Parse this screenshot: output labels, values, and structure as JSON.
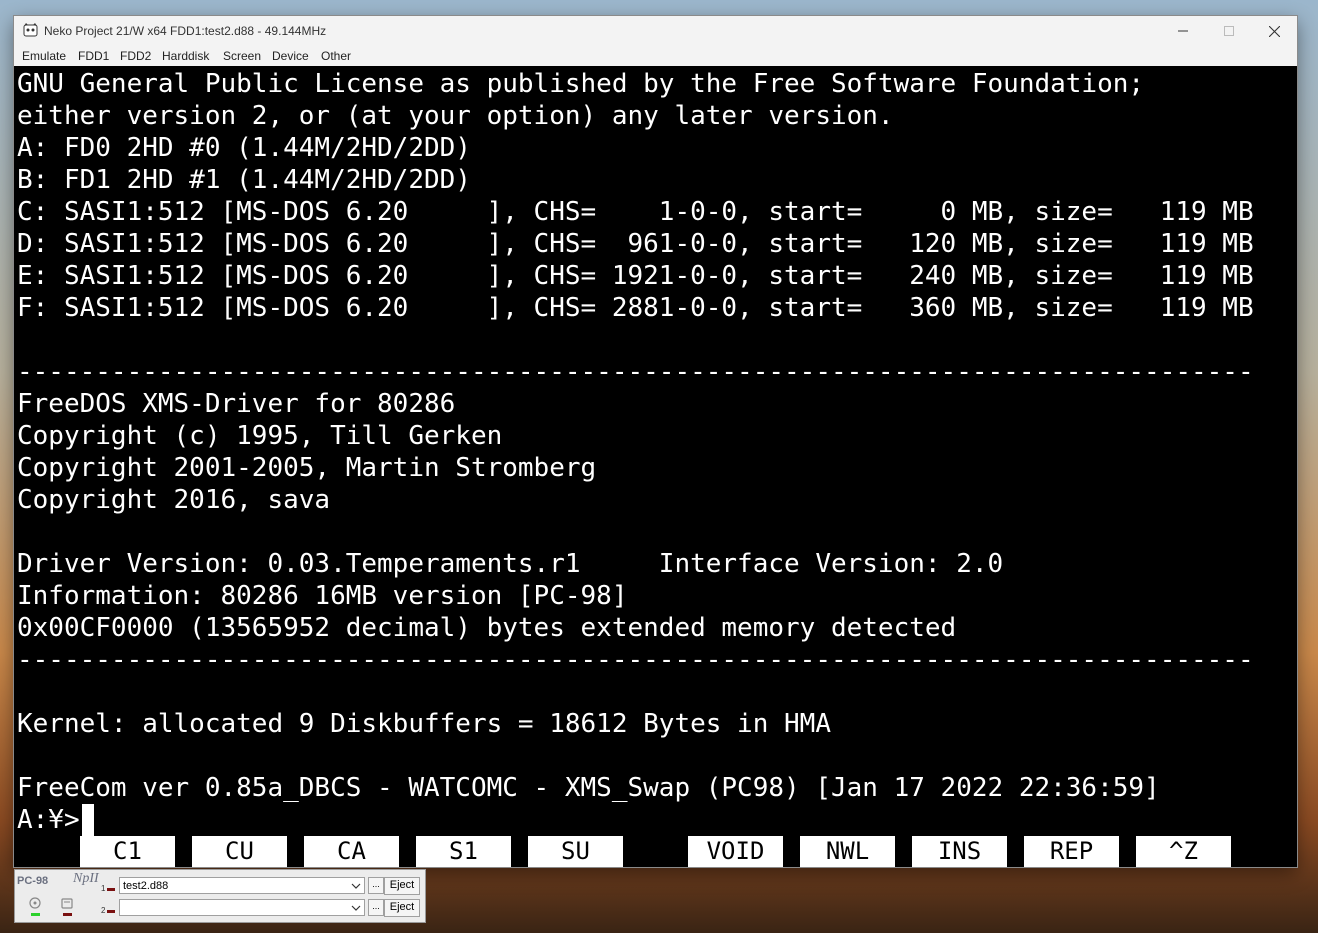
{
  "window": {
    "title": "Neko Project 21/W x64  FDD1:test2.d88 - 49.144MHz"
  },
  "menu": [
    "Emulate",
    "FDD1",
    "FDD2",
    "Harddisk",
    "Screen",
    "Device",
    "Other"
  ],
  "screen_lines": [
    "GNU General Public License as published by the Free Software Foundation;",
    "either version 2, or (at your option) any later version.",
    "A: FD0 2HD #0 (1.44M/2HD/2DD)",
    "B: FD1 2HD #1 (1.44M/2HD/2DD)",
    "C: SASI1:512 [MS-DOS 6.20     ], CHS=    1-0-0, start=     0 MB, size=   119 MB",
    "D: SASI1:512 [MS-DOS 6.20     ], CHS=  961-0-0, start=   120 MB, size=   119 MB",
    "E: SASI1:512 [MS-DOS 6.20     ], CHS= 1921-0-0, start=   240 MB, size=   119 MB",
    "F: SASI1:512 [MS-DOS 6.20     ], CHS= 2881-0-0, start=   360 MB, size=   119 MB",
    "",
    "-------------------------------------------------------------------------------",
    "FreeDOS XMS-Driver for 80286",
    "Copyright (c) 1995, Till Gerken",
    "Copyright 2001-2005, Martin Stromberg",
    "Copyright 2016, sava",
    "",
    "Driver Version: 0.03.Temperaments.r1     Interface Version: 2.0",
    "Information: 80286 16MB version [PC-98]",
    "0x00CF0000 (13565952 decimal) bytes extended memory detected",
    "-------------------------------------------------------------------------------",
    "",
    "",
    "Kernel: allocated 9 Diskbuffers = 18612 Bytes in HMA",
    "",
    "FreeCom ver 0.85a_DBCS - WATCOMC - XMS_Swap (PC98) [Jan 17 2022 22:36:59]",
    "A:¥>"
  ],
  "function_keys": [
    "C1",
    "CU",
    "CA",
    "S1",
    "SU",
    "VOID",
    "NWL",
    "INS",
    "REP",
    "^Z"
  ],
  "panel": {
    "logo_left": "PC-98",
    "logo_right": "NpII",
    "drive1_num": "1",
    "drive2_num": "2",
    "drive1_file": "test2.d88",
    "drive2_file": "",
    "browse_label": "...",
    "eject_label": "Eject"
  },
  "colors": {
    "screen_bg": "#000000",
    "screen_fg": "#ffffff",
    "led_green": "#2bd12b",
    "led_red": "#7a1010"
  },
  "icons": [
    "app-icon",
    "minimize-icon",
    "maximize-icon",
    "close-icon",
    "chevron-down-icon",
    "drive-icon"
  ]
}
